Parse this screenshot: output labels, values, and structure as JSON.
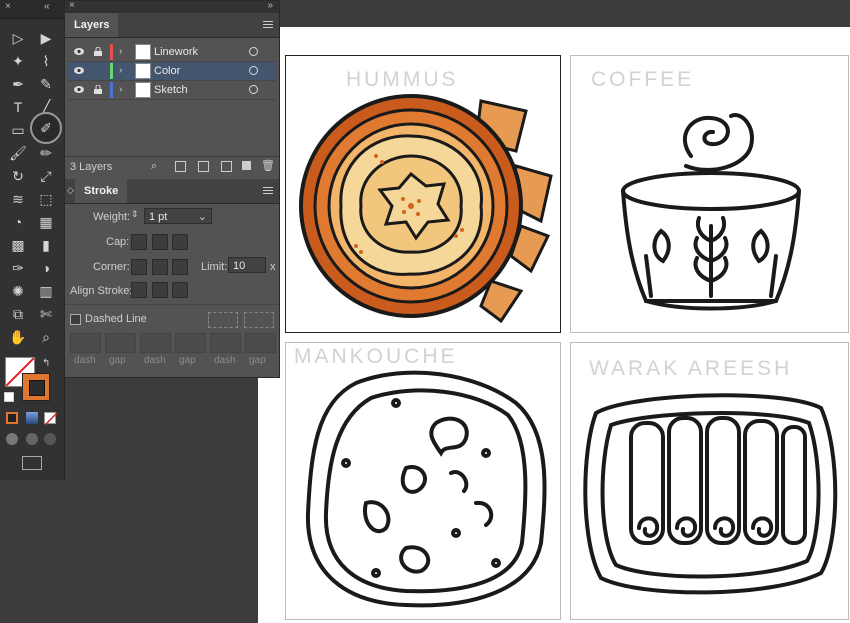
{
  "toolbox": {
    "collapse_label": "«",
    "close_label": "×",
    "tools": [
      "selection-tool",
      "direct-selection-tool",
      "magic-wand-tool",
      "lasso-tool",
      "pen-tool",
      "curvature-tool",
      "type-tool",
      "line-tool",
      "rectangle-tool",
      "shaper-tool",
      "paintbrush-tool",
      "pencil-tool",
      "rotate-tool",
      "scale-tool",
      "width-tool",
      "free-transform-tool",
      "shape-builder-tool",
      "perspective-grid-tool",
      "mesh-tool",
      "gradient-tool",
      "eyedropper-tool",
      "blend-tool",
      "symbol-sprayer-tool",
      "graph-tool",
      "artboard-tool",
      "slice-tool",
      "hand-tool",
      "zoom-tool"
    ],
    "fill_color": "#ffffff",
    "stroke_color": "#e0762f"
  },
  "layers_panel": {
    "tab_label": "Layers",
    "layers": [
      {
        "name": "Linework",
        "color": "#e05050",
        "locked": true
      },
      {
        "name": "Color",
        "color": "#6ad56a",
        "locked": false,
        "selected": true
      },
      {
        "name": "Sketch",
        "color": "#4c72e0",
        "locked": true
      }
    ],
    "count_label": "3 Layers"
  },
  "stroke_panel": {
    "tab_label": "Stroke",
    "weight_label": "Weight:",
    "weight_value": "1 pt",
    "cap_label": "Cap:",
    "corner_label": "Corner:",
    "limit_label": "Limit:",
    "limit_value": "10",
    "limit_unit": "x",
    "align_label": "Align Stroke:",
    "dashed_label": "Dashed Line",
    "dash_labels": [
      "dash",
      "gap",
      "dash",
      "gap",
      "dash",
      "gap"
    ]
  },
  "artboards": [
    {
      "title": "HUMMUS",
      "active": true
    },
    {
      "title": "COFFEE",
      "active": false
    },
    {
      "title": "MANKOUCHE",
      "active": false
    },
    {
      "title": "WARAK AREESH",
      "active": false
    }
  ],
  "colors": {
    "orange": "#d5621f",
    "light_orange": "#f0a865",
    "cream": "#f6d79a",
    "dark": "#1a1a1a"
  }
}
